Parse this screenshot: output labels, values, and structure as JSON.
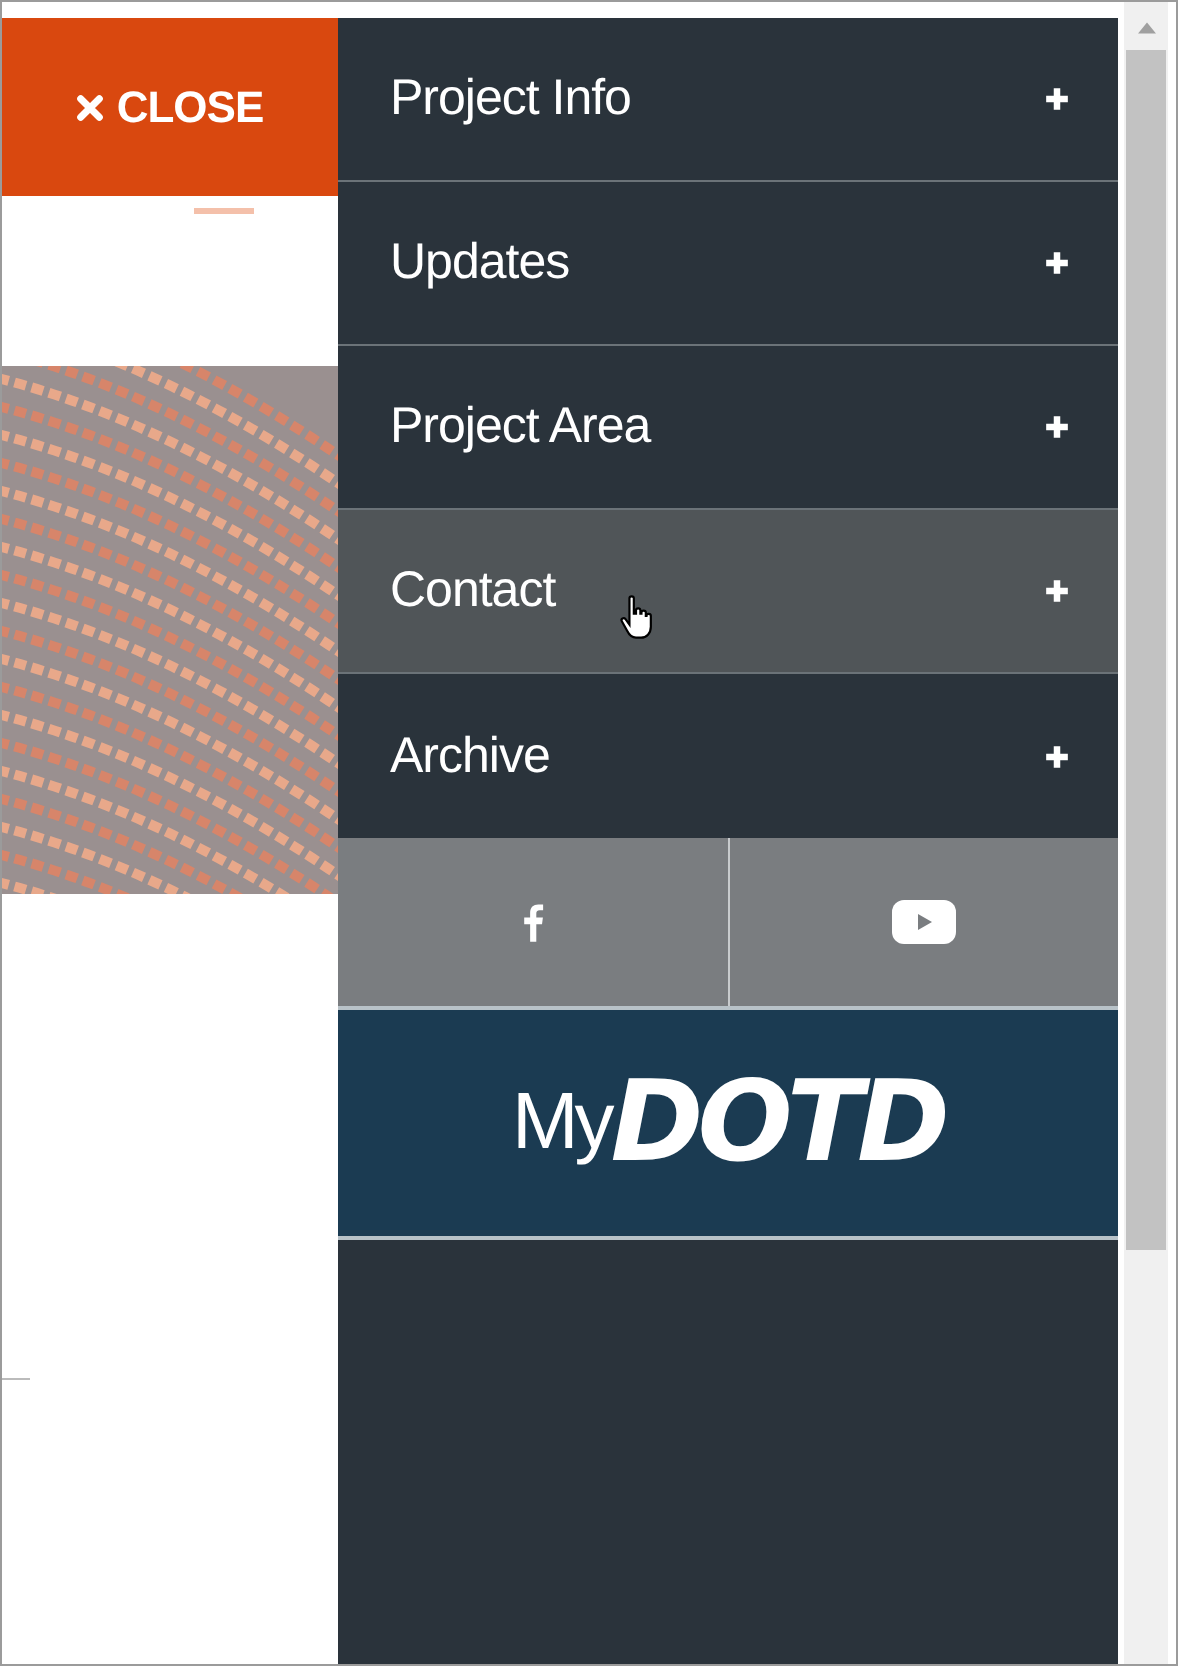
{
  "close_button": {
    "label": "CLOSE"
  },
  "menu": {
    "items": [
      {
        "label": "Project Info",
        "highlighted": false
      },
      {
        "label": "Updates",
        "highlighted": false
      },
      {
        "label": "Project Area",
        "highlighted": false
      },
      {
        "label": "Contact",
        "highlighted": true
      },
      {
        "label": "Archive",
        "highlighted": false
      }
    ],
    "social": [
      {
        "kind": "facebook"
      },
      {
        "kind": "youtube"
      }
    ],
    "logo": {
      "prefix": "My",
      "name": "DOTD"
    }
  }
}
